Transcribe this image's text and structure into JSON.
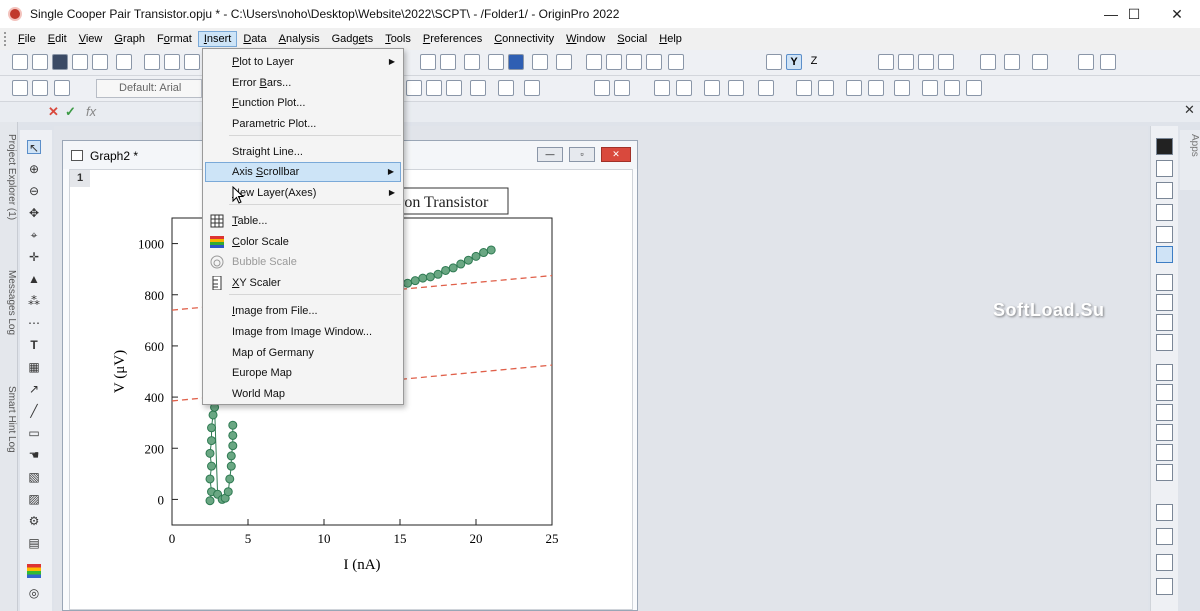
{
  "window": {
    "title": "Single Cooper Pair Transistor.opju * - C:\\Users\\noho\\Desktop\\Website\\2022\\SCPT\\ - /Folder1/ - OriginPro 2022",
    "minimize": "—",
    "maximize": "☐",
    "close": "✕"
  },
  "menubar": {
    "items": [
      {
        "pre": "",
        "ul": "F",
        "post": "ile"
      },
      {
        "pre": "",
        "ul": "E",
        "post": "dit"
      },
      {
        "pre": "",
        "ul": "V",
        "post": "iew"
      },
      {
        "pre": "",
        "ul": "G",
        "post": "raph"
      },
      {
        "pre": "F",
        "ul": "o",
        "post": "rmat"
      },
      {
        "pre": "",
        "ul": "I",
        "post": "nsert"
      },
      {
        "pre": "",
        "ul": "D",
        "post": "ata"
      },
      {
        "pre": "",
        "ul": "A",
        "post": "nalysis"
      },
      {
        "pre": "Gadg",
        "ul": "e",
        "post": "ts"
      },
      {
        "pre": "",
        "ul": "T",
        "post": "ools"
      },
      {
        "pre": "",
        "ul": "P",
        "post": "references"
      },
      {
        "pre": "",
        "ul": "C",
        "post": "onnectivity"
      },
      {
        "pre": "",
        "ul": "W",
        "post": "indow"
      },
      {
        "pre": "",
        "ul": "S",
        "post": "ocial"
      },
      {
        "pre": "",
        "ul": "H",
        "post": "elp"
      }
    ]
  },
  "toolbar": {
    "font_box": "Default: Arial",
    "y_button": "Y",
    "z_button": "Z"
  },
  "formula_bar": {
    "fx": "fx"
  },
  "left_dock": {
    "tabs": [
      "Project Explorer (1)",
      "Messages Log",
      "Smart Hint Log"
    ]
  },
  "right_dock": {
    "apps_tab": "Apps"
  },
  "graph_window": {
    "title": "Graph2 *",
    "layer_number": "1",
    "title_partial": "ron Transistor"
  },
  "insert_menu": {
    "items": [
      {
        "pre": "",
        "ul": "P",
        "post": "lot to Layer",
        "submenu": true
      },
      {
        "pre": "Error ",
        "ul": "B",
        "post": "ars...",
        "submenu": false
      },
      {
        "pre": "",
        "ul": "F",
        "post": "unction Plot...",
        "submenu": false
      },
      {
        "pre": "Parametric Plot...",
        "ul": "",
        "post": "",
        "submenu": false
      },
      {
        "pre": "Straight Line...",
        "ul": "",
        "post": "",
        "submenu": false
      },
      {
        "pre": "Axis ",
        "ul": "S",
        "post": "crollbar",
        "submenu": true,
        "highlighted": true
      },
      {
        "pre": "",
        "ul": "N",
        "post": "ew Layer(Axes)",
        "submenu": true
      },
      {
        "pre": "",
        "ul": "T",
        "post": "able...",
        "submenu": false,
        "icon": "table-icon"
      },
      {
        "pre": "",
        "ul": "C",
        "post": "olor Scale",
        "submenu": false,
        "icon": "color-scale-icon"
      },
      {
        "pre": "Bubble Scale",
        "ul": "",
        "post": "",
        "submenu": false,
        "icon": "bubble-scale-icon",
        "disabled": true
      },
      {
        "pre": "",
        "ul": "X",
        "post": "Y Scaler",
        "submenu": false,
        "icon": "xy-scaler-icon"
      },
      {
        "pre": "",
        "ul": "I",
        "post": "mage from File...",
        "submenu": false
      },
      {
        "pre": "Image from Image Window...",
        "ul": "",
        "post": "",
        "submenu": false
      },
      {
        "pre": "Map of Germany",
        "ul": "",
        "post": "",
        "submenu": false
      },
      {
        "pre": "Europe Map",
        "ul": "",
        "post": "",
        "submenu": false
      },
      {
        "pre": "World Map",
        "ul": "",
        "post": "",
        "submenu": false
      }
    ]
  },
  "watermark": "SoftLoad.Su",
  "chart_data": {
    "type": "scatter",
    "title": "",
    "xlabel": "I (nA)",
    "ylabel": "V (μV)",
    "xlim": [
      0,
      25
    ],
    "ylim": [
      -100,
      1100
    ],
    "xticks": [
      "0",
      "5",
      "10",
      "15",
      "20",
      "25"
    ],
    "yticks": [
      "0",
      "200",
      "400",
      "600",
      "800",
      "1000"
    ],
    "colors": {
      "marker_fill": "#6aa783",
      "marker_edge": "#2e7a52",
      "fit_line": "#e0604a"
    },
    "series": [
      {
        "x": [
          2.5,
          2.6,
          2.5,
          2.6,
          2.5,
          2.6,
          2.6,
          2.7,
          2.8,
          3.0,
          3.3,
          3.5,
          3.7,
          3.8,
          3.9,
          3.9,
          4.0,
          4.0,
          4.0
        ],
        "y": [
          -5,
          30,
          80,
          130,
          180,
          230,
          280,
          330,
          360,
          20,
          0,
          5,
          30,
          80,
          130,
          170,
          210,
          250,
          290
        ]
      },
      {
        "x": [
          15.0,
          15.5,
          16.0,
          16.5,
          17.0,
          17.5,
          18.0,
          18.5,
          19.0,
          19.5,
          20.0,
          20.5,
          21.0
        ],
        "y": [
          835,
          845,
          855,
          865,
          870,
          880,
          895,
          905,
          920,
          935,
          950,
          965,
          975
        ]
      }
    ],
    "fit_lines": [
      {
        "x": [
          0,
          25
        ],
        "y": [
          740,
          875
        ]
      },
      {
        "x": [
          0,
          25
        ],
        "y": [
          385,
          525
        ]
      }
    ]
  }
}
